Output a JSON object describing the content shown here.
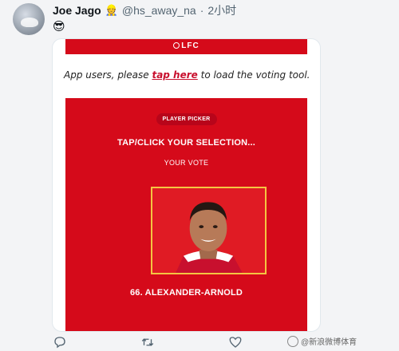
{
  "tweet": {
    "display_name": "Joe Jago",
    "name_emoji": "👷",
    "handle": "@hs_away_na",
    "separator": "·",
    "time": "2小时",
    "text": "😎"
  },
  "media": {
    "brand_bar": "LFC",
    "notice_prefix": "App users, please ",
    "notice_link": "tap here",
    "notice_suffix": " to load the voting tool.",
    "picker_badge": "PLAYER PICKER",
    "heading": "TAP/CLICK YOUR SELECTION...",
    "subheading": "YOUR VOTE",
    "player_name": "66. ALEXANDER-ARNOLD"
  },
  "actions": {
    "reply_icon": "reply-icon",
    "retweet_icon": "retweet-icon",
    "like_icon": "heart-icon"
  },
  "watermark": {
    "text": "@新浪微博体育"
  },
  "colors": {
    "lfc_red": "#d50a1a",
    "card_border": "#f4c542",
    "link_red": "#c8102e"
  }
}
